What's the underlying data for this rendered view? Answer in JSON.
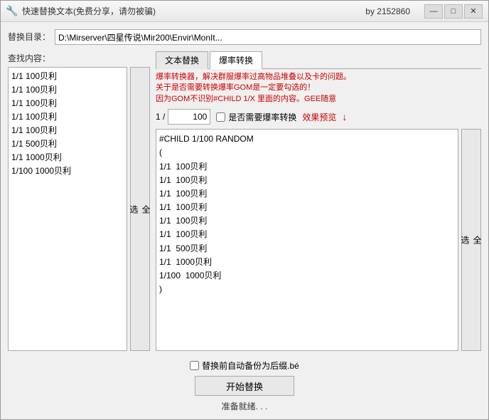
{
  "window": {
    "title": "快速替换文本(免费分享，请勿被骗)",
    "by": "by 2152860",
    "icon": "🔧",
    "controls": {
      "minimize": "—",
      "maximize": "□",
      "close": "✕"
    }
  },
  "form": {
    "dir_label": "替换目录：",
    "dir_value": "D:\\Mirserver\\四星传说\\Mir200\\Envir\\MonIt...",
    "search_label": "查找内容：",
    "select_all": "全\n选"
  },
  "left_list": {
    "items": [
      "1/1  100贝利",
      "1/1  100贝利",
      "1/1  100贝利",
      "1/1  100贝利",
      "1/1  100贝利",
      "1/1  500贝利",
      "1/1  1000贝利",
      "1/100  1000贝利"
    ]
  },
  "tabs": {
    "text_replace": "文本替换",
    "boom_convert": "爆率转换"
  },
  "boom_panel": {
    "info_line1": "爆率转换器，解决群服爆率过高物品堆叠以及卡的问题。",
    "info_line2": "关于是否需要转换爆率GOM是一定要勾选的！",
    "info_line3": "因为GOM不识别#CHILD 1/X 里面的内容。GEE随意",
    "fraction_prefix": "1 /",
    "fraction_value": "100",
    "checkbox_label": "是否需要爆率转换",
    "preview_label": "效果预览",
    "preview_arrow": "↓",
    "select_all": "全\n选",
    "preview_content": "#CHILD 1/100 RANDOM\n(\n1/1  100贝利\n1/1  100贝利\n1/1  100贝利\n1/1  100贝利\n1/1  100贝利\n1/1  100贝利\n1/1  500贝利\n1/1  1000贝利\n1/100  1000贝利\n)"
  },
  "bottom": {
    "backup_checkbox": "",
    "backup_label": "替换前自动备份为后缀.bé",
    "start_btn": "开始替换",
    "status": "准备就绪. . ."
  }
}
